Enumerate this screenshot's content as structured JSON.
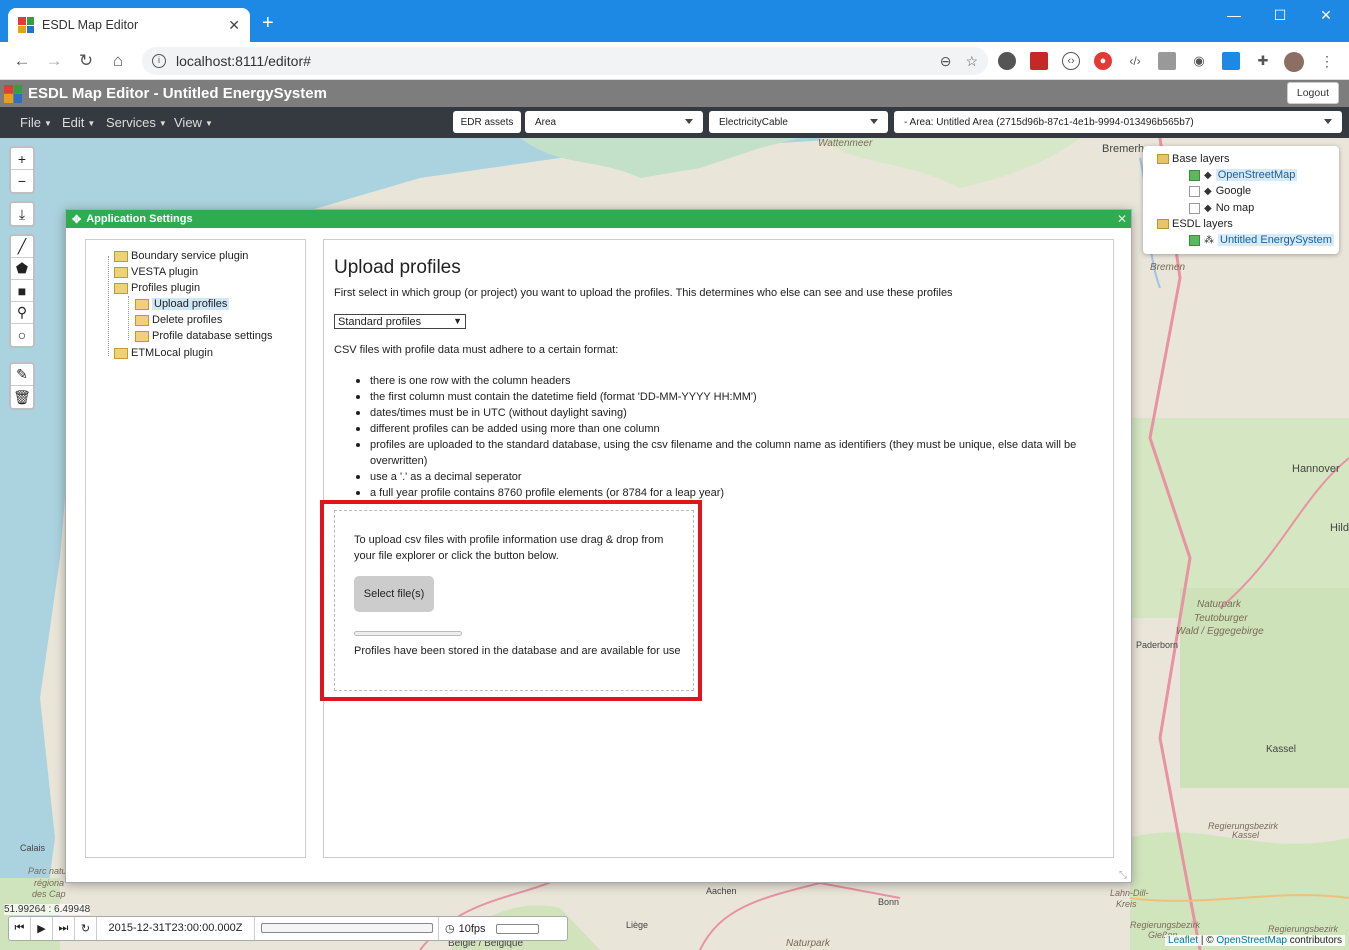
{
  "browser": {
    "tab_title": "ESDL Map Editor",
    "tab_close": "✕",
    "new_tab": "+",
    "url": "localhost:8111/editor#",
    "window_min": "—",
    "window_max": "☐",
    "window_close": "✕"
  },
  "app": {
    "title": "ESDL Map Editor - Untitled EnergySystem",
    "logout_label": "Logout"
  },
  "menu": {
    "items": [
      "File",
      "Edit",
      "Services",
      "View"
    ],
    "edr_label": "EDR assets",
    "area_select": "Area",
    "asset_select": "ElectricityCable",
    "area_path_select": "- Area: Untitled Area (2715d96b-87c1-4e1b-9994-013496b565b7)"
  },
  "map": {
    "labels": [
      "Wattenmeer",
      "Bremerha",
      "Bremen",
      "Hannover",
      "Hild",
      "Naturpark",
      "Teutoburger",
      "Wald / Eggegebirge",
      "Paderborn",
      "Kassel",
      "Regierungsbezirk",
      "Kassel",
      "Calais",
      "Parc natu",
      "régiona",
      "des Cap",
      "Aachen",
      "Bonn",
      "Liège",
      "Lahn-Dill-",
      "Kreis",
      "Regierungsbezirk",
      "Gießen",
      "Regierungsbezirk",
      "Naturpark",
      "Belgie / Belgique"
    ],
    "coords": "51.99264 : 6.49948"
  },
  "layers": {
    "base_label": "Base layers",
    "items": [
      "OpenStreetMap",
      "Google",
      "No map"
    ],
    "esdl_label": "ESDL layers",
    "esdl_items": [
      "Untitled EnergySystem"
    ]
  },
  "modal": {
    "title": "Application Settings",
    "tree": [
      "Boundary service plugin",
      "VESTA plugin",
      "Profiles plugin",
      "Upload profiles",
      "Delete profiles",
      "Profile database settings",
      "ETMLocal plugin"
    ],
    "heading": "Upload profiles",
    "intro": "First select in which group (or project) you want to upload the profiles. This determines who else can see and use these profiles",
    "group_select": "Standard profiles",
    "csv_intro": "CSV files with profile data must adhere to a certain format:",
    "rules": [
      "there is one row with the column headers",
      "the first column must contain the datetime field (format 'DD-MM-YYYY HH:MM')",
      "dates/times must be in UTC (without daylight saving)",
      "different profiles can be added using more than one column",
      "profiles are uploaded to the standard database, using the csv filename and the column name as identifiers (they must be unique, else data will be overwritten)",
      "use a '.' as a decimal seperator",
      "a full year profile contains 8760 profile elements (or 8784 for a leap year)"
    ],
    "upload_text": "To upload csv files with profile information use drag & drop from your file explorer or click the button below.",
    "select_button": "Select file(s)",
    "upload_progress": 0,
    "stored_text": "Profiles have been stored in the database and are available for use"
  },
  "timebar": {
    "date": "2015-12-31T23:00:00.000Z",
    "fps": "10fps"
  },
  "attribution": {
    "leaflet": "Leaflet",
    "sep": " | © ",
    "osm": "OpenStreetMap",
    "contributors": " contributors"
  }
}
